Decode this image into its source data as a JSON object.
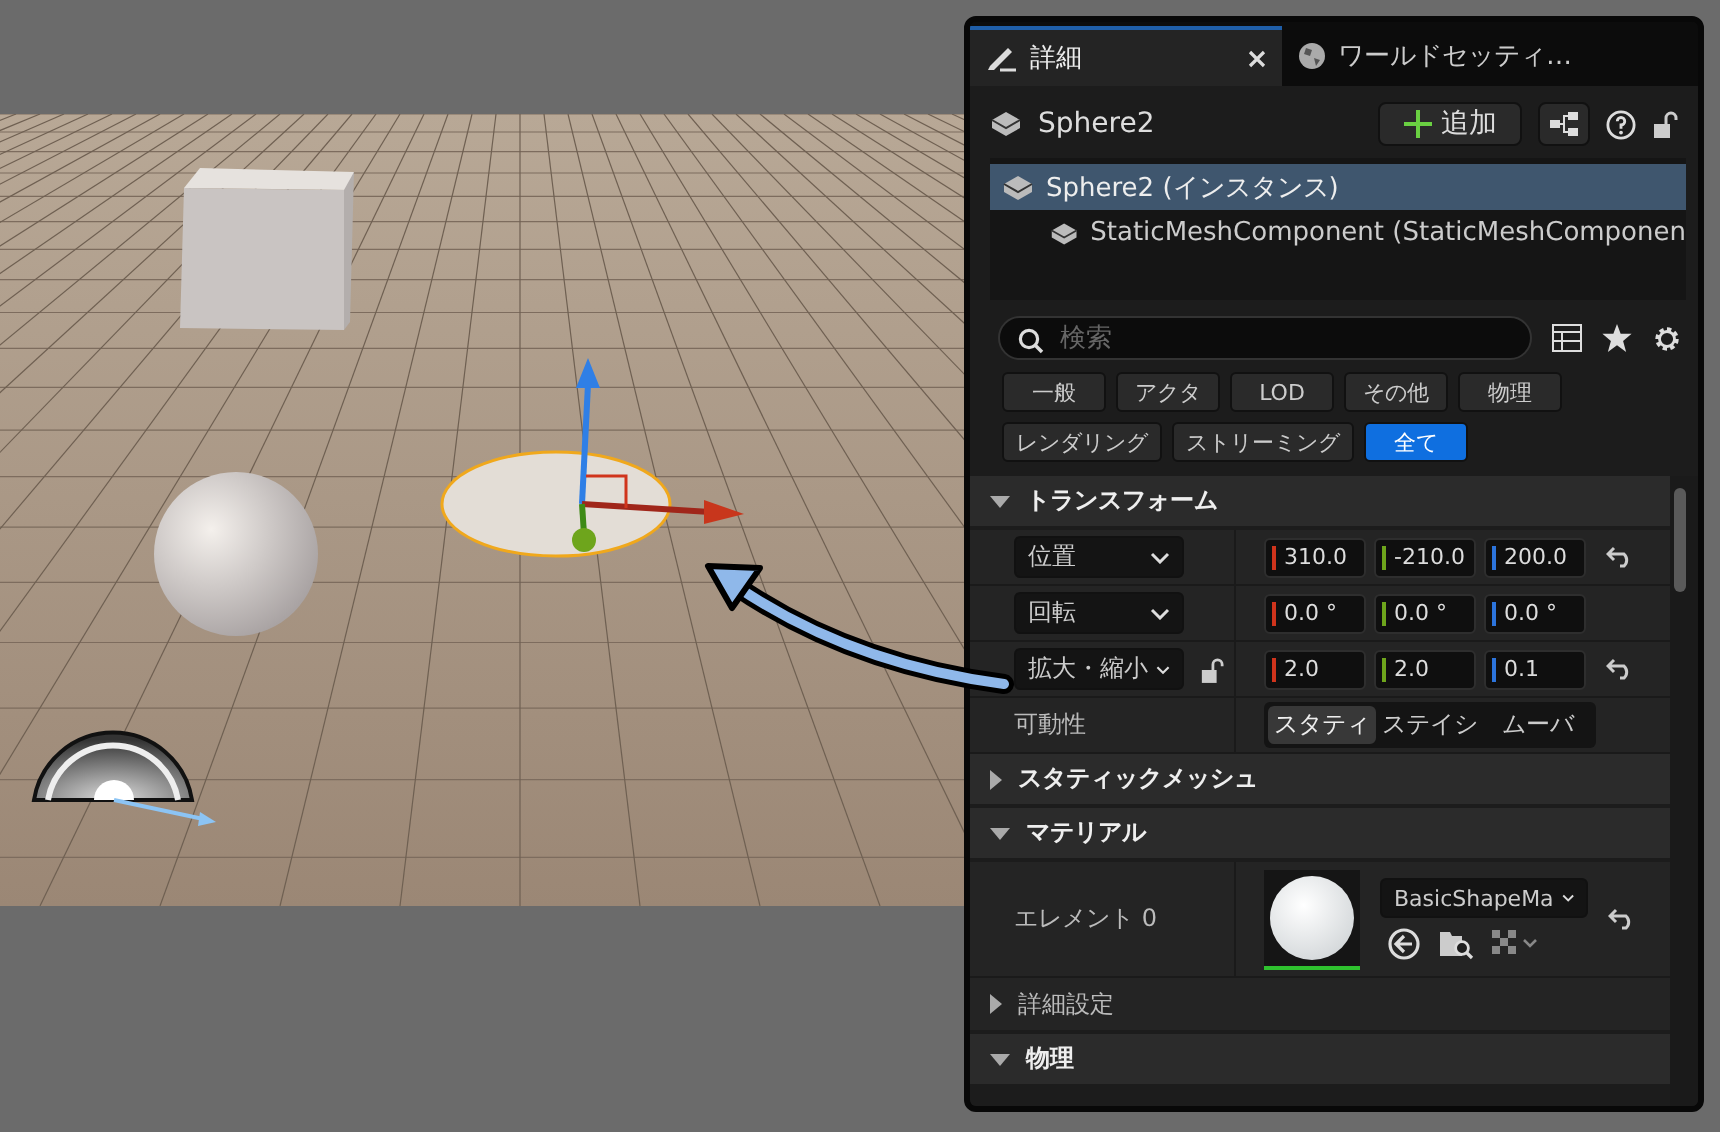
{
  "tabs": [
    {
      "label": "詳細",
      "selected": true,
      "closable": true
    },
    {
      "label": "ワールドセッティ…",
      "selected": false,
      "closable": false
    }
  ],
  "actor": {
    "name": "Sphere2",
    "add_button": "追加"
  },
  "components": [
    {
      "label": "Sphere2 (インスタンス)",
      "selected": true,
      "children": [
        {
          "label": "StaticMeshComponent (StaticMeshComponen",
          "selected": false
        }
      ]
    }
  ],
  "search": {
    "placeholder": "検索"
  },
  "filters": [
    {
      "label": "一般",
      "selected": false
    },
    {
      "label": "アクタ",
      "selected": false
    },
    {
      "label": "LOD",
      "selected": false
    },
    {
      "label": "その他",
      "selected": false
    },
    {
      "label": "物理",
      "selected": false
    },
    {
      "label": "レンダリング",
      "selected": false
    },
    {
      "label": "ストリーミング",
      "selected": false
    },
    {
      "label": "全て",
      "selected": true
    }
  ],
  "sections": [
    {
      "title": "トランスフォーム",
      "expanded": true,
      "rows": [
        {
          "kind": "vector",
          "label": "位置",
          "lock": false,
          "reset": true,
          "values": [
            {
              "text": "310.0",
              "color": "#d0341c"
            },
            {
              "text": "-210.0",
              "color": "#6ea51c"
            },
            {
              "text": "200.0",
              "color": "#2c74dc"
            }
          ]
        },
        {
          "kind": "vector",
          "label": "回転",
          "lock": false,
          "reset": false,
          "values": [
            {
              "text": "0.0 °",
              "color": "#d0341c"
            },
            {
              "text": "0.0 °",
              "color": "#6ea51c"
            },
            {
              "text": "0.0 °",
              "color": "#2c74dc"
            }
          ]
        },
        {
          "kind": "vector",
          "label": "拡大・縮小",
          "lock": true,
          "reset": true,
          "values": [
            {
              "text": "2.0",
              "color": "#d0341c"
            },
            {
              "text": "2.0",
              "color": "#6ea51c"
            },
            {
              "text": "0.1",
              "color": "#2c74dc"
            }
          ]
        },
        {
          "kind": "segmented",
          "label": "可動性",
          "options": [
            {
              "label": "スタティ",
              "selected": true
            },
            {
              "label": "ステイシ",
              "selected": false
            },
            {
              "label": "ムーバ",
              "selected": false
            }
          ]
        }
      ]
    },
    {
      "title": "スタティックメッシュ",
      "expanded": false
    },
    {
      "title": "マテリアル",
      "expanded": true,
      "rows": [
        {
          "kind": "material",
          "label": "エレメント 0",
          "asset": "BasicShapeMa",
          "reset": true
        },
        {
          "kind": "group",
          "label": "詳細設定",
          "expanded": false
        }
      ]
    },
    {
      "title": "物理",
      "expanded": true
    }
  ]
}
